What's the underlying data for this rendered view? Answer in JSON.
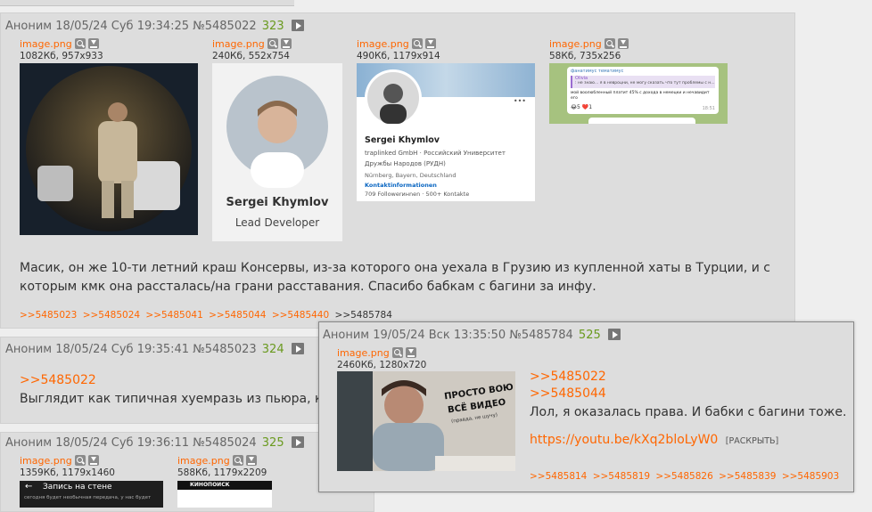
{
  "posts": [
    {
      "author": "Аноним",
      "date": "18/05/24 Суб 19:34:25",
      "number": "№5485022",
      "count": "323",
      "files": [
        {
          "name": "image.png",
          "meta": "1082Кб, 957x933"
        },
        {
          "name": "image.png",
          "meta": "240Кб, 552x754"
        },
        {
          "name": "image.png",
          "meta": "490Кб, 1179x914"
        },
        {
          "name": "image.png",
          "meta": "58Кб, 735x256"
        }
      ],
      "thumb2": {
        "name": "Sergei Khymlov",
        "role": "Lead Developer"
      },
      "thumb3": {
        "name": "Sergei Khymlov",
        "line1": "traplinked GmbH  ·  Российский Университет",
        "line2": "Дружбы Народов (РУДН)",
        "line3": "Nürnberg, Bayern, Deutschland",
        "contact": "Kontaktinformationen",
        "stats": "709 Followerинnen  ·  500+ Kontakte",
        "dots": "•••"
      },
      "thumb4": {
        "l1": "фанатимус тематимус",
        "l2": "Olivia",
        "l3": ": не знаю... я в невроцни, не могу сказать что тут проблемы с н...",
        "l4": "мой воолюбленный платит 45% с дохода в немецки и нечавидит",
        "l5": "его",
        "react": "😂5 ❤️1",
        "time": "18:51"
      },
      "text1": "Масик, он же 10-ти летний краш Консервы, из-за которого она уехала в Грузию из купленной хаты в Турции, и с",
      "text2": "которым кмк она рассталась/на грани расставания. Спасибо бабкам с багини за инфу.",
      "replies": [
        ">>5485023",
        ">>5485024",
        ">>5485041",
        ">>5485044",
        ">>5485440"
      ],
      "reply_last": ">>5485784"
    },
    {
      "author": "Аноним",
      "date": "18/05/24 Суб 19:35:41",
      "number": "№5485023",
      "count": "324",
      "reply": ">>5485022",
      "text": "Выглядит как типичная хуемразь из пьюра, кот"
    },
    {
      "author": "Аноним",
      "date": "18/05/24 Суб 19:36:11",
      "number": "№5485024",
      "count": "325",
      "files": [
        {
          "name": "image.png",
          "meta": "1359Кб, 1179x1460"
        },
        {
          "name": "image.png",
          "meta": "588Кб, 1179x2209"
        }
      ],
      "thumb1_text": "Запись на стене",
      "thumb1_sub": "сегодня будет необычная передача, у нас будет",
      "thumb2_text": "КИНОПОИСК"
    }
  ],
  "popup": {
    "author": "Аноним",
    "date": "19/05/24 Вск 13:35:50",
    "number": "№5485784",
    "count": "525",
    "file": {
      "name": "image.png",
      "meta": "2460Кб, 1280x720"
    },
    "thumb_text1": "ПРОСТО ВОЮ",
    "thumb_text2": "ВСЁ ВИДЕО",
    "thumb_text3": "(правда, не шучу)",
    "reply1": ">>5485022",
    "reply2": ">>5485044",
    "text": "Лол, я оказалась права. И бабки с багини тоже.",
    "link": "https://youtu.be/kXq2bloLyW0",
    "expand": "[РАСКРЫТЬ]",
    "replies": [
      ">>5485814",
      ">>5485819",
      ">>5485826",
      ">>5485839",
      ">>5485903"
    ]
  }
}
